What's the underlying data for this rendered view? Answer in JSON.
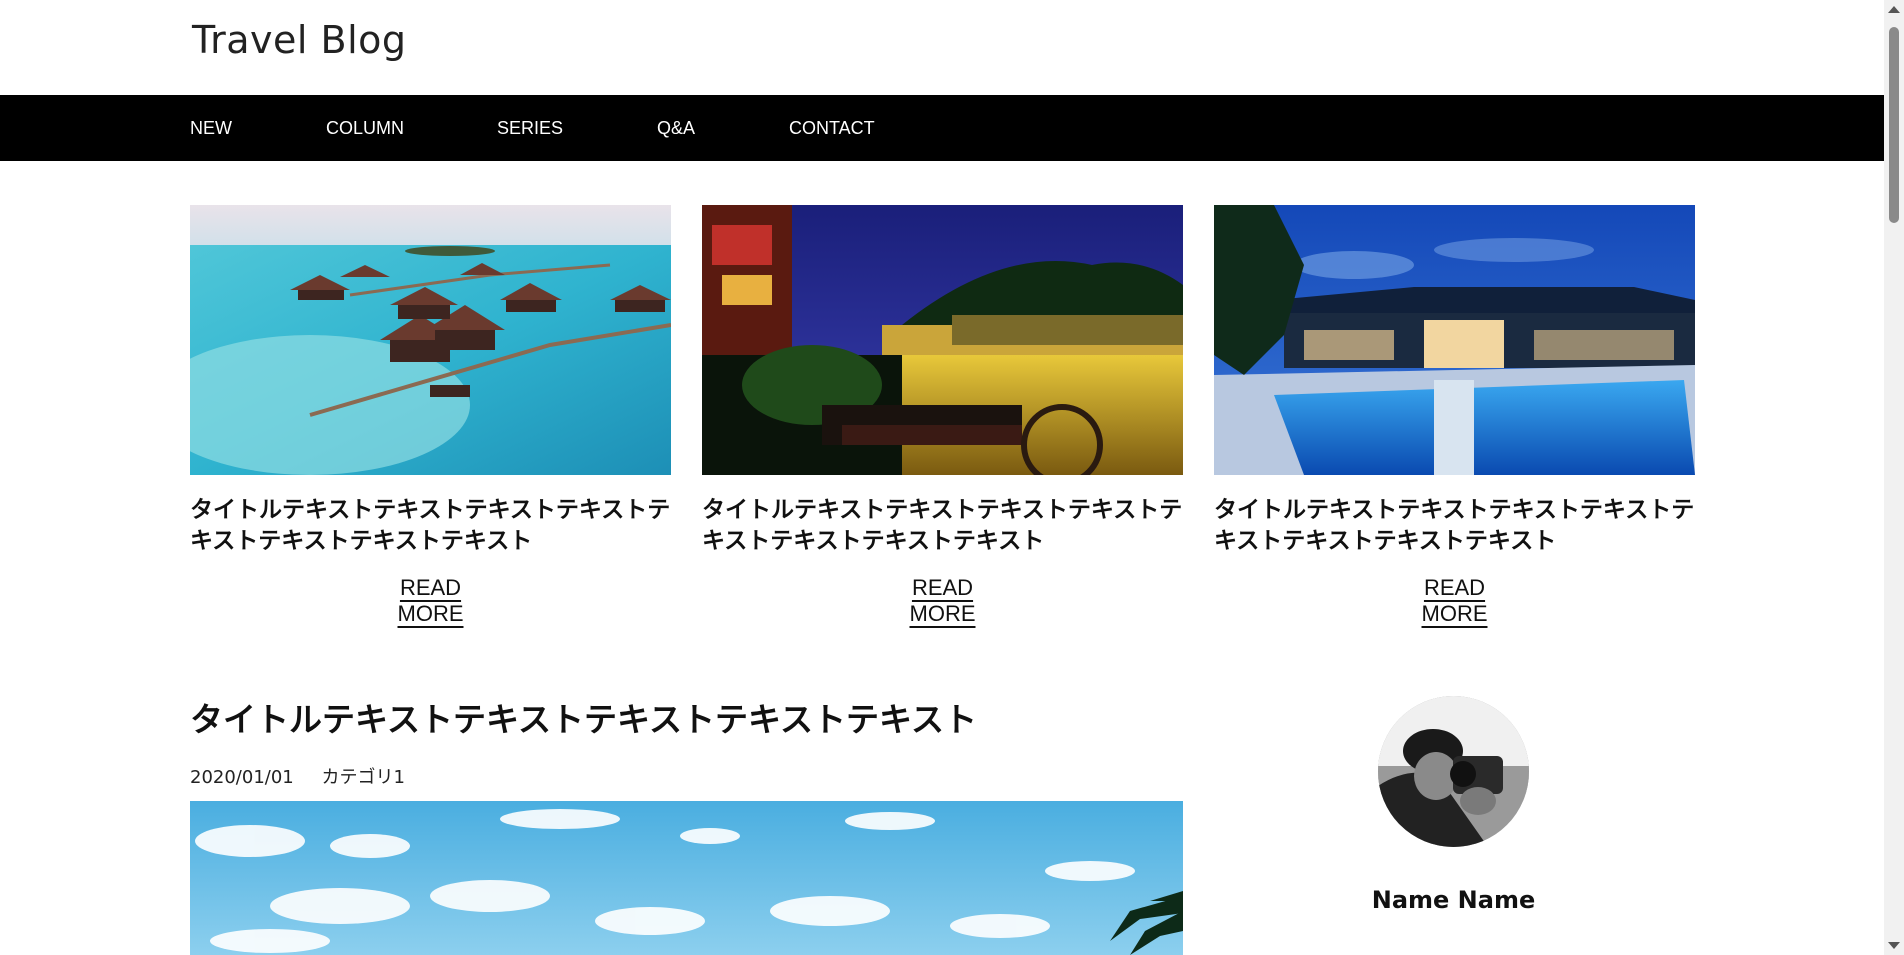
{
  "header": {
    "site_title": "Travel Blog"
  },
  "nav": {
    "items": [
      {
        "label": "NEW"
      },
      {
        "label": "COLUMN"
      },
      {
        "label": "SERIES"
      },
      {
        "label": "Q&A"
      },
      {
        "label": "CONTACT"
      }
    ]
  },
  "featured": [
    {
      "title": "タイトルテキストテキストテキストテキストテキストテキストテキストテキスト",
      "read_more": "READ MORE",
      "image": "overwater-bungalows-photo"
    },
    {
      "title": "タイトルテキストテキストテキストテキストテキストテキストテキストテキスト",
      "read_more": "READ MORE",
      "image": "night-river-town-photo"
    },
    {
      "title": "タイトルテキストテキストテキストテキストテキストテキストテキストテキスト",
      "read_more": "READ MORE",
      "image": "resort-pool-night-photo"
    }
  ],
  "post": {
    "title": "タイトルテキストテキストテキストテキストテキスト",
    "date": "2020/01/01",
    "category": "カテゴリ1",
    "image": "blue-sky-palm-photo"
  },
  "profile": {
    "name": "Name Name",
    "avatar": "photographer-avatar"
  },
  "colors": {
    "nav_bg": "#000000",
    "nav_text": "#ffffff",
    "page_bg": "#ffffff",
    "text": "#111111"
  }
}
